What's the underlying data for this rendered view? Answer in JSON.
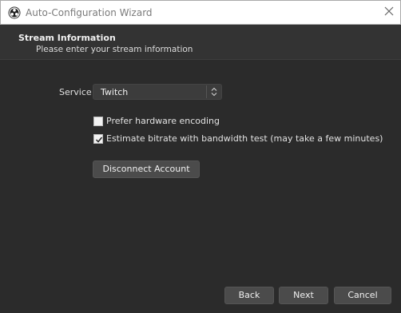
{
  "window": {
    "title": "Auto-Configuration Wizard"
  },
  "header": {
    "title": "Stream Information",
    "subtitle": "Please enter your stream information"
  },
  "form": {
    "service_label": "Service",
    "service_value": "Twitch",
    "prefer_hw_label": "Prefer hardware encoding",
    "prefer_hw_checked": false,
    "estimate_bitrate_label": "Estimate bitrate with bandwidth test (may take a few minutes)",
    "estimate_bitrate_checked": true,
    "disconnect_label": "Disconnect Account"
  },
  "footer": {
    "back_label": "Back",
    "next_label": "Next",
    "cancel_label": "Cancel"
  },
  "icons": {
    "app": "obs-logo-icon",
    "close": "close-icon",
    "select": "spin-arrows-icon",
    "check": "checkmark-icon"
  }
}
